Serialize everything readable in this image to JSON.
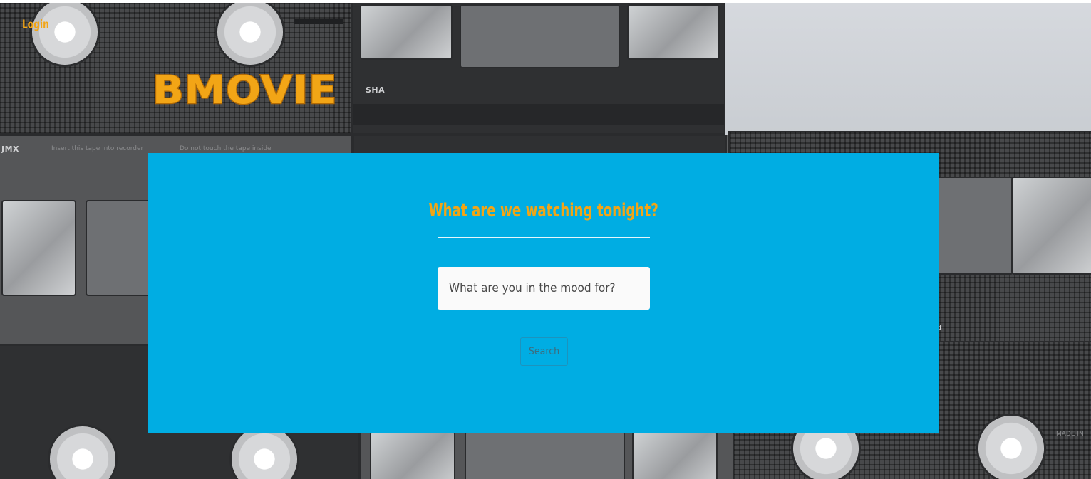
{
  "header": {
    "login_label": "Login",
    "brand_name": "BMOVIE"
  },
  "hero": {
    "headline": "What are we watching tonight?",
    "search_placeholder": "What are you in the mood for?",
    "search_button_label": "Search"
  },
  "background": {
    "tape_labels": [
      "SHA",
      "JMX",
      "d"
    ],
    "tape_fine_print": [
      "Insert this tape into recorder",
      "Do not touch the tape inside",
      "MADE IN"
    ]
  },
  "colors": {
    "accent": "#f2a516",
    "panel": "#00ade3",
    "input_bg": "#fafafa",
    "button_border": "#1d93bd"
  }
}
